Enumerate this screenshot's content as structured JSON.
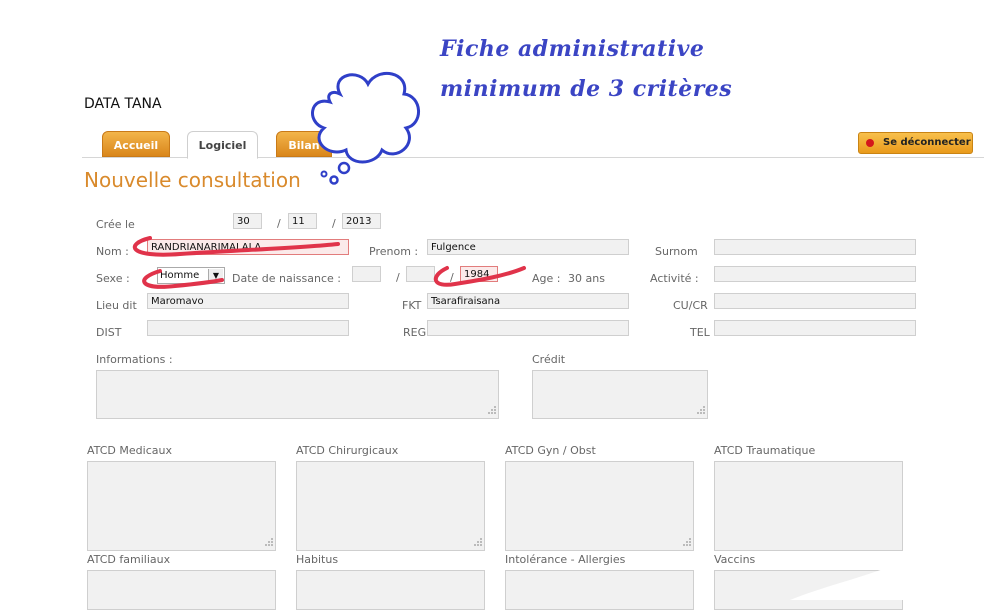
{
  "app_title": "DATA TANA",
  "annotation": {
    "line1": "Fiche administrative",
    "line2": "minimum de 3 critères"
  },
  "tabs": [
    {
      "label": "Accueil"
    },
    {
      "label": "Logiciel"
    },
    {
      "label": "Bilan"
    }
  ],
  "logout_label": "Se déconnecter",
  "page_heading": "Nouvelle consultation",
  "form": {
    "cree_le_label": "Crée le",
    "date_day": "30",
    "date_month": "11",
    "date_year": "2013",
    "slash": "/",
    "nom_label": "Nom :",
    "nom_value": "RANDRIANARIMALALA",
    "prenom_label": "Prenom :",
    "prenom_value": "Fulgence",
    "surnom_label": "Surnom",
    "sexe_label": "Sexe :",
    "sexe_value": "Homme",
    "dob_label": "Date de naissance :",
    "dob_year": "1984",
    "age_label": "Age :",
    "age_value": "30 ans",
    "activite_label": "Activité :",
    "lieu_label": "Lieu dit",
    "lieu_value": "Maromavo",
    "fkt_label": "FKT",
    "fkt_value": "Tsarafiraisana",
    "cucr_label": "CU/CR",
    "dist_label": "DIST",
    "reg_label": "REG",
    "tel_label": "TEL",
    "informations_label": "Informations :",
    "credit_label": "Crédit"
  },
  "atcd": {
    "row1": [
      "ATCD Medicaux",
      "ATCD Chirurgicaux",
      "ATCD Gyn / Obst",
      "ATCD Traumatique"
    ],
    "row2": [
      "ATCD familiaux",
      "Habitus",
      "Intolérance - Allergies",
      "Vaccins"
    ]
  },
  "colors": {
    "accent_orange": "#d98a2c",
    "annotation_blue": "#3b45c4",
    "highlight_red": "#e0334a"
  }
}
